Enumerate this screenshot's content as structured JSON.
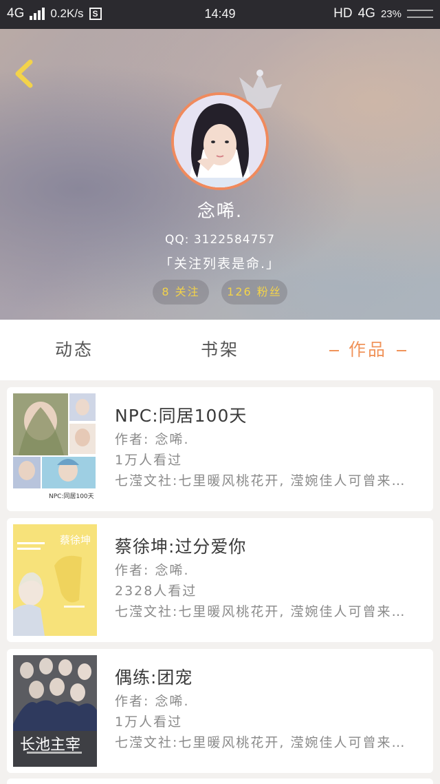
{
  "status_bar": {
    "network": "4G",
    "speed": "0.2K/s",
    "s_icon": "S",
    "time": "14:49",
    "hd": "HD",
    "network_right": "4G",
    "battery": "23%"
  },
  "profile": {
    "back_icon": "chevron-left-icon",
    "nickname": "念唏.",
    "qq": "QQ: 3122584757",
    "signature": "「关注列表是命.」",
    "following": "8 关注",
    "fans": "126 粉丝"
  },
  "tabs": [
    {
      "label": "动态",
      "active": false
    },
    {
      "label": "书架",
      "active": false
    },
    {
      "label": "作品",
      "active": true
    }
  ],
  "books": [
    {
      "title": "NPC:同居100天",
      "author": "作者: 念唏.",
      "views": "1万人看过",
      "publisher": "七滢文社:七里暖风桃花开, 滢婉佳人可曾来…",
      "cover_text": "NPC:同居100天"
    },
    {
      "title": "蔡徐坤:过分爱你",
      "author": "作者: 念唏.",
      "views": "2328人看过",
      "publisher": "七滢文社:七里暖风桃花开, 滢婉佳人可曾来…",
      "cover_text": "蔡徐坤"
    },
    {
      "title": "偶练:团宠",
      "author": "作者: 念唏.",
      "views": "1万人看过",
      "publisher": "七滢文社:七里暖风桃花开, 滢婉佳人可曾来…",
      "cover_text": "长池主宰"
    }
  ],
  "colors": {
    "accent": "#f0935a",
    "stat_text": "#f3d34a",
    "back_icon": "#f3d34a"
  }
}
